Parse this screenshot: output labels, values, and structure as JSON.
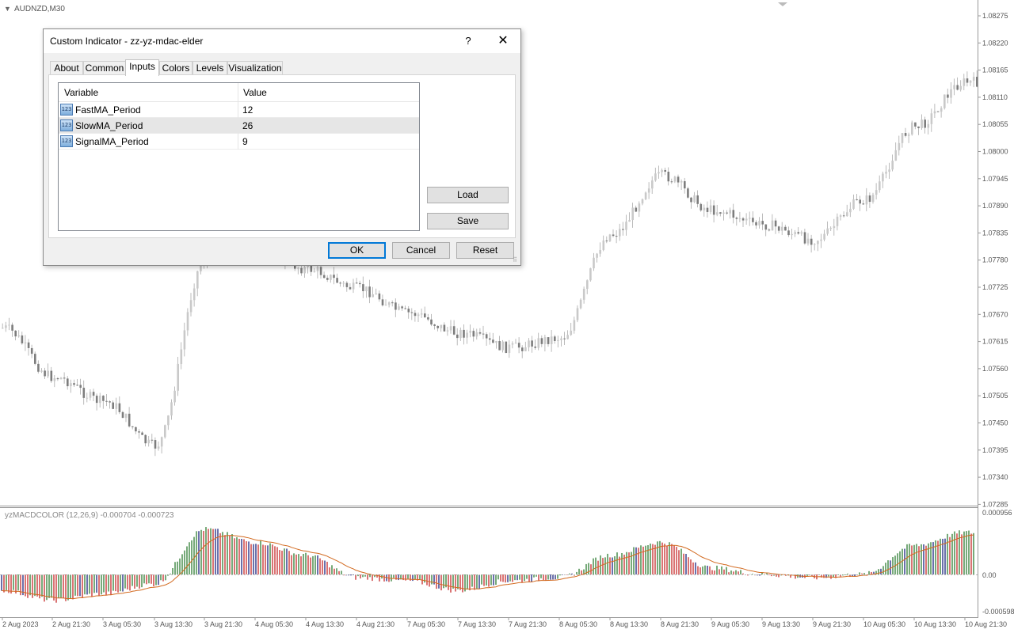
{
  "chart": {
    "symbol": "AUDNZD,M30",
    "indicator_label": "yzMACDCOLOR (12,26,9) -0.000704 -0.000723",
    "price_ticks": [
      "1.08275",
      "1.08220",
      "1.08165",
      "1.08110",
      "1.08055",
      "1.08000",
      "1.07945",
      "1.07890",
      "1.07835",
      "1.07780",
      "1.07725",
      "1.07670",
      "1.07615",
      "1.07560",
      "1.07505",
      "1.07450",
      "1.07395",
      "1.07340",
      "1.07285"
    ],
    "indicator_ticks": [
      "0.000956",
      "0.00",
      "-0.000598"
    ],
    "time_ticks": [
      "2 Aug 2023",
      "2 Aug 21:30",
      "3 Aug 05:30",
      "3 Aug 13:30",
      "3 Aug 21:30",
      "4 Aug 05:30",
      "4 Aug 13:30",
      "4 Aug 21:30",
      "7 Aug 05:30",
      "7 Aug 13:30",
      "7 Aug 21:30",
      "8 Aug 05:30",
      "8 Aug 13:30",
      "8 Aug 21:30",
      "9 Aug 05:30",
      "9 Aug 13:30",
      "9 Aug 21:30",
      "10 Aug 05:30",
      "10 Aug 13:30",
      "10 Aug 21:30"
    ],
    "colors": {
      "candle": "#9a9a9a",
      "hist_up": "#2e7d32",
      "hist_down": "#c62828",
      "hist_flat": "#1a237e",
      "signal": "#d2691e"
    }
  },
  "chart_data": {
    "type": "line",
    "title": "",
    "price_range": [
      1.07285,
      1.08275
    ],
    "indicator_range": [
      -0.000598,
      0.000956
    ],
    "x": [
      "2 Aug 2023",
      "2 Aug 21:30",
      "3 Aug 05:30",
      "3 Aug 13:30",
      "3 Aug 21:30",
      "4 Aug 05:30",
      "4 Aug 13:30",
      "4 Aug 21:30",
      "7 Aug 05:30",
      "7 Aug 13:30",
      "7 Aug 21:30",
      "8 Aug 05:30",
      "8 Aug 13:30",
      "8 Aug 21:30",
      "9 Aug 05:30",
      "9 Aug 13:30",
      "9 Aug 21:30",
      "10 Aug 05:30",
      "10 Aug 13:30",
      "10 Aug 21:30"
    ],
    "series": [
      {
        "values": [
          1.0764,
          1.0754,
          1.0749,
          1.074,
          1.0778,
          1.0781,
          1.0776,
          1.0772,
          1.0767,
          1.0763,
          1.076,
          1.0762,
          1.0783,
          1.0795,
          1.0788,
          1.0785,
          1.0782,
          1.079,
          1.0805,
          1.0814
        ]
      },
      {
        "values": [
          -0.00025,
          -0.0004,
          -0.0003,
          -0.00015,
          0.0007,
          0.0005,
          0.0003,
          -5e-05,
          -0.0001,
          -0.00025,
          -0.0001,
          -5e-05,
          0.0003,
          0.0005,
          0.0001,
          0.0,
          -5e-05,
          0.0,
          0.00045,
          0.00065
        ]
      }
    ]
  },
  "dialog": {
    "title": "Custom Indicator - zz-yz-mdac-elder",
    "help": "?",
    "close": "✕",
    "tabs": [
      "About",
      "Common",
      "Inputs",
      "Colors",
      "Levels",
      "Visualization"
    ],
    "active_tab": "Inputs",
    "table": {
      "headers": [
        "Variable",
        "Value"
      ],
      "icon_text": "123",
      "rows": [
        {
          "name": "FastMA_Period",
          "value": "12"
        },
        {
          "name": "SlowMA_Period",
          "value": "26"
        },
        {
          "name": "SignalMA_Period",
          "value": "9"
        }
      ]
    },
    "load": "Load",
    "save": "Save",
    "ok": "OK",
    "cancel": "Cancel",
    "reset": "Reset"
  }
}
